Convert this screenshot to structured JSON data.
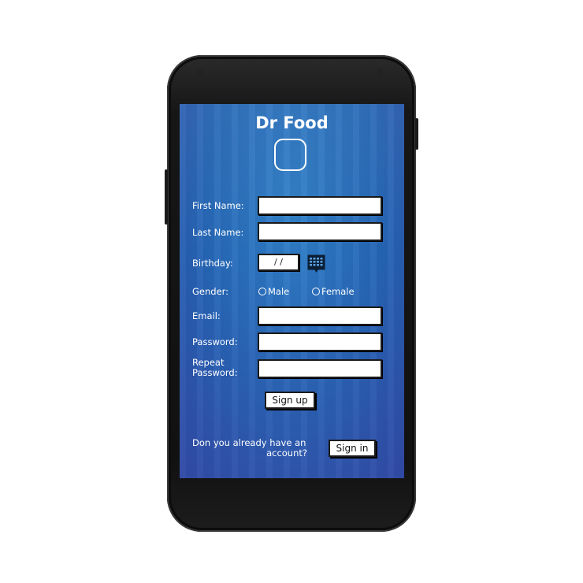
{
  "app": {
    "title": "Dr Food",
    "logo_icon": "rounded-square-logo"
  },
  "form": {
    "first_name": {
      "label": "First Name:",
      "value": ""
    },
    "last_name": {
      "label": "Last Name:",
      "value": ""
    },
    "birthday": {
      "label": "Birthday:",
      "value": " /  /",
      "icon": "calendar-icon"
    },
    "gender": {
      "label": "Gender:",
      "options": [
        "Male",
        "Female"
      ]
    },
    "email": {
      "label": "Email:",
      "value": ""
    },
    "password": {
      "label": "Password:",
      "value": ""
    },
    "repeat_password": {
      "label_line1": "Repeat",
      "label_line2": "Password:",
      "value": ""
    },
    "signup_label": "Sign up"
  },
  "footer": {
    "question_line1": "Don you already have an",
    "question_line2": "account?",
    "signin_label": "Sign in"
  },
  "colors": {
    "screen_blue": "#2566b6",
    "text": "#ffffff",
    "field_bg": "#ffffff",
    "border": "#1a1a1a"
  }
}
